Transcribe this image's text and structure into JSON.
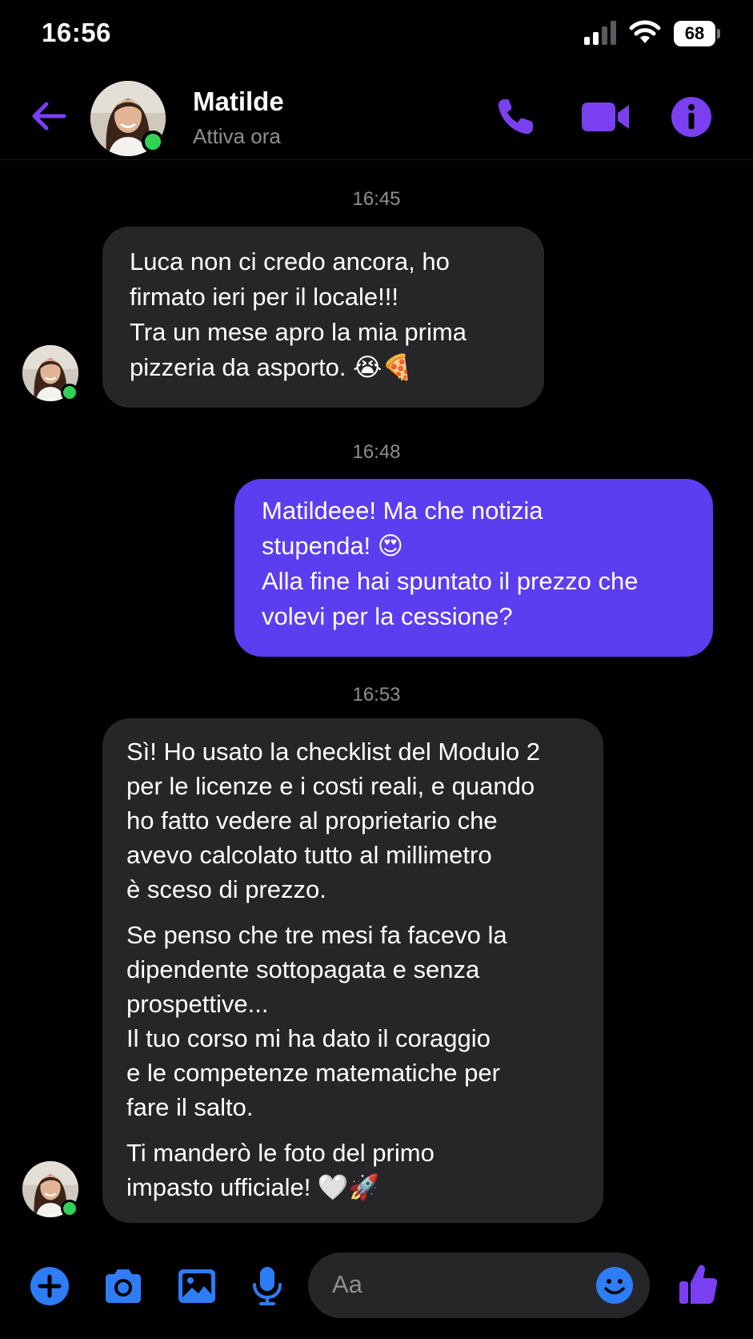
{
  "status_bar": {
    "time": "16:56",
    "battery": "68"
  },
  "header": {
    "name": "Matilde",
    "status": "Attiva ora",
    "avatar": "contact-photo",
    "icons": [
      "back-arrow-icon",
      "phone-icon",
      "video-camera-icon",
      "info-icon"
    ]
  },
  "messages": [
    {
      "time": "16:45"
    },
    {
      "direction": "incoming",
      "lines": [
        "Luca non ci credo ancora, ho",
        "firmato ieri per il locale!!!",
        "Tra un mese apro la mia prima",
        "pizzeria da asporto. 😭🍕"
      ]
    },
    {
      "time": "16:48"
    },
    {
      "direction": "outgoing",
      "lines": [
        "Matildeee! Ma che notizia",
        "stupenda! 😍",
        "Alla fine hai spuntato il prezzo che",
        "volevi per la cessione?"
      ]
    },
    {
      "time": "16:53"
    },
    {
      "direction": "incoming",
      "para1": [
        "Sì! Ho usato la checklist del Modulo 2",
        "per le licenze e i costi reali, e quando",
        "ho fatto vedere al proprietario che",
        "avevo calcolato tutto al millimetro",
        "è sceso di prezzo."
      ],
      "para2": [
        "Se penso che tre mesi fa facevo la",
        "dipendente sottopagata e senza",
        "prospettive...",
        "Il tuo corso mi ha dato il coraggio",
        "e le competenze matematiche per",
        "fare il salto."
      ],
      "para3": [
        "Ti manderò le foto del primo",
        "impasto ufficiale! 🤍🚀"
      ]
    }
  ],
  "composer": {
    "placeholder": "Aa",
    "icons": [
      "plus-icon",
      "camera-icon",
      "gallery-icon",
      "microphone-icon",
      "emoji-icon",
      "thumbs-up-icon"
    ]
  },
  "colors": {
    "accent": "#7b3ff2",
    "outgoing_bubble": "#5b3ef0",
    "incoming_bubble": "#262628",
    "online": "#31d158",
    "blue_icons": "#2e7cf6"
  }
}
